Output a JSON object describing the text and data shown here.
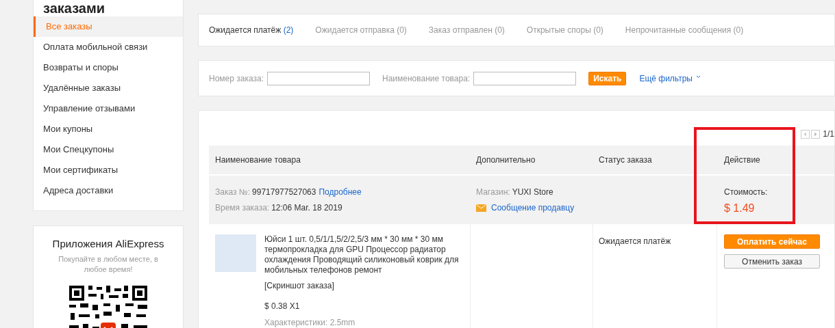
{
  "sidebar": {
    "title": "заказами",
    "items": [
      {
        "label": "Все заказы",
        "selected": true
      },
      {
        "label": "Оплата мобильной связи",
        "selected": false
      },
      {
        "label": "Возвраты и споры",
        "selected": false
      },
      {
        "label": "Удалённые заказы",
        "selected": false
      },
      {
        "label": "Управление отзывами",
        "selected": false
      },
      {
        "label": "Мои купоны",
        "selected": false
      },
      {
        "label": "Мои Спецкупоны",
        "selected": false
      },
      {
        "label": "Мои сертификаты",
        "selected": false
      },
      {
        "label": "Адреса доставки",
        "selected": false
      }
    ]
  },
  "app_promo": {
    "title": "Приложения AliExpress",
    "subtitle": "Покупайте в любом месте, в любое время!"
  },
  "tabs": [
    {
      "label": "Ожидается платёж",
      "count": "(2)",
      "selected": true
    },
    {
      "label": "Ожидается отправка",
      "count": "(0)",
      "selected": false
    },
    {
      "label": "Заказ отправлен",
      "count": "(0)",
      "selected": false
    },
    {
      "label": "Открытые споры",
      "count": "(0)",
      "selected": false
    },
    {
      "label": "Непрочитанные сообщения",
      "count": "(0)",
      "selected": false
    }
  ],
  "filters": {
    "order_number_label": "Номер заказа:",
    "product_name_label": "Наименование товара:",
    "search_button": "Искать",
    "more_filters": "Ещё фильтры"
  },
  "pagination": {
    "page": "1/1"
  },
  "table": {
    "columns": [
      "Наименование товара",
      "Дополнительно",
      "Статус заказа",
      "Действие"
    ],
    "order": {
      "number_label": "Заказ №:",
      "number": "99717977527063",
      "details_link": "Подробнее",
      "time_label": "Время заказа:",
      "time": "12:06 Mar. 18 2019",
      "store_label": "Магазин:",
      "store": "YUXI Store",
      "message_link": "Сообщение продавцу",
      "cost_label": "Стоимость:",
      "cost": "$ 1.49"
    },
    "item": {
      "title": "Юйси 1 шт. 0,5/1/1,5/2/2,5/3 мм * 30 мм * 30 мм термопрокладка для GPU Процессор радиатор охлаждения Проводящий силиконовый коврик для мобильных телефонов ремонт",
      "snapshot_link": "[Скриншот заказа]",
      "price": "$ 0.38 X1",
      "specs": "Характеристики: 2.5mm",
      "status": "Ожидается платёж",
      "buttons": [
        {
          "label": "Оплатить сейчас",
          "kind": "primary"
        },
        {
          "label": "Отменить заказ",
          "kind": "secondary"
        }
      ]
    }
  }
}
